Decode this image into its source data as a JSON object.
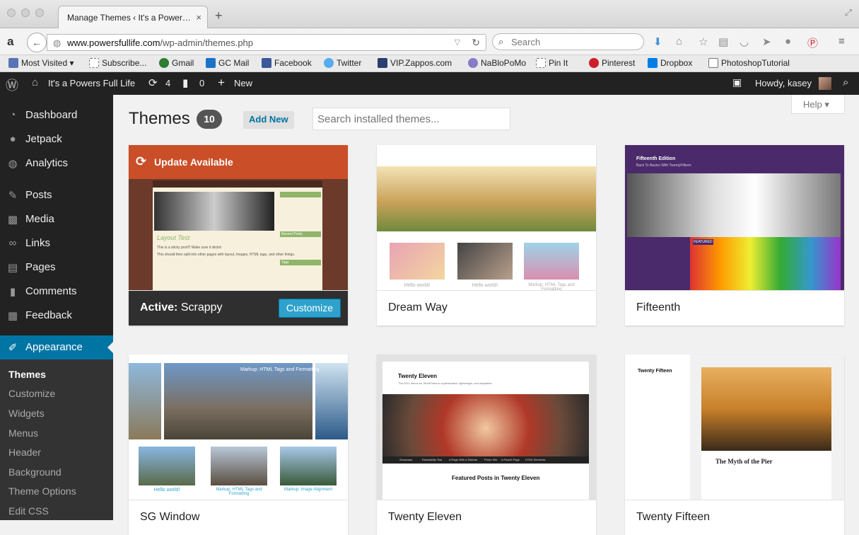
{
  "browser": {
    "tab_title": "Manage Themes ‹ It's a Power…",
    "tab_close": "×",
    "new_tab": "+",
    "url_host": "www.powersfullife.com",
    "url_path": "/wp-admin/themes.php",
    "search_placeholder": "Search",
    "bookmarks": [
      {
        "label": "Most Visited ▾",
        "color": "#5a73b5"
      },
      {
        "label": "Subscribe...",
        "color": "#ffffff"
      },
      {
        "label": "Gmail",
        "color": "#2e7d32"
      },
      {
        "label": "GC Mail",
        "color": "#1a73c8"
      },
      {
        "label": "Facebook",
        "color": "#3b5998"
      },
      {
        "label": "Twitter",
        "color": "#55acee"
      },
      {
        "label": "VIP.Zappos.com",
        "color": "#2c3e70"
      },
      {
        "label": "NaBloPoMo",
        "color": "#8a7bc8"
      },
      {
        "label": "Pin It",
        "color": "#ffffff"
      },
      {
        "label": "Pinterest",
        "color": "#cb2027"
      },
      {
        "label": "Dropbox",
        "color": "#007ee5"
      },
      {
        "label": "PhotoshopTutorial",
        "color": "#ffffff"
      }
    ]
  },
  "adminbar": {
    "site_name": "It's a Powers Full Life",
    "updates_count": "4",
    "comments_count": "0",
    "new_label": "New",
    "howdy": "Howdy, kasey"
  },
  "sidebar": {
    "items": [
      {
        "label": "Dashboard",
        "icon": "dashboard-icon"
      },
      {
        "label": "Jetpack",
        "icon": "jetpack-icon"
      },
      {
        "label": "Analytics",
        "icon": "analytics-icon"
      },
      {
        "label": "Posts",
        "icon": "pushpin-icon"
      },
      {
        "label": "Media",
        "icon": "media-icon"
      },
      {
        "label": "Links",
        "icon": "link-icon"
      },
      {
        "label": "Pages",
        "icon": "pages-icon"
      },
      {
        "label": "Comments",
        "icon": "comment-icon"
      },
      {
        "label": "Feedback",
        "icon": "feedback-icon"
      },
      {
        "label": "Appearance",
        "icon": "paintbrush-icon"
      }
    ],
    "submenu": [
      "Themes",
      "Customize",
      "Widgets",
      "Menus",
      "Header",
      "Background",
      "Theme Options",
      "Edit CSS"
    ]
  },
  "main": {
    "title": "Themes",
    "count": "10",
    "add_new": "Add New",
    "search_placeholder": "Search installed themes...",
    "help": "Help"
  },
  "themes": [
    {
      "active_prefix": "Active:",
      "name": "Scrappy",
      "update": "Update Available",
      "customize": "Customize"
    },
    {
      "name": "Dream Way"
    },
    {
      "name": "Fifteenth"
    },
    {
      "name": "SG Window"
    },
    {
      "name": "Twenty Eleven"
    },
    {
      "name": "Twenty Fifteen"
    }
  ],
  "theme_previews": {
    "scrappy": {
      "post_title": "Layout Test",
      "sidebar_heading_1": "Recent Posts",
      "sidebar_heading_2": "Tags",
      "body_1": "This is a sticky post!!! Make sure it sticks!",
      "body_2": "This should then split into other pages with layout, images, HTML tags, and other things."
    },
    "dreamway": {
      "caption_1": "Hello world!",
      "caption_2": "Hello world!",
      "caption_3": "Markup: HTML Tags and Formatting"
    },
    "fifteenth": {
      "heading": "Fifteenth Edition",
      "tagline": "Back To Basics With TwentyFifteen",
      "featured": "FEATURED"
    },
    "sgwindow": {
      "banner": "Markup: HTML Tags and Formatting",
      "caption_1": "Hello world!",
      "caption_2": "Markup: HTML Tags and Formatting",
      "caption_3": "Markup: Image Alignment"
    },
    "twentyeleven": {
      "heading": "Twenty Eleven",
      "tagline": "The 2011 theme for WordPress is sophisticated, lightweight, and adaptable.",
      "featured_title": "Featured Posts in Twenty Eleven",
      "nav": [
        "Showcase",
        "Readability Test",
        "A Page With a Sidebar",
        "Photo Site",
        "A Parent Page",
        "HTML Elements"
      ]
    },
    "twentyfifteen": {
      "heading": "Twenty Fifteen",
      "post_title": "The Myth of the Pier"
    }
  }
}
